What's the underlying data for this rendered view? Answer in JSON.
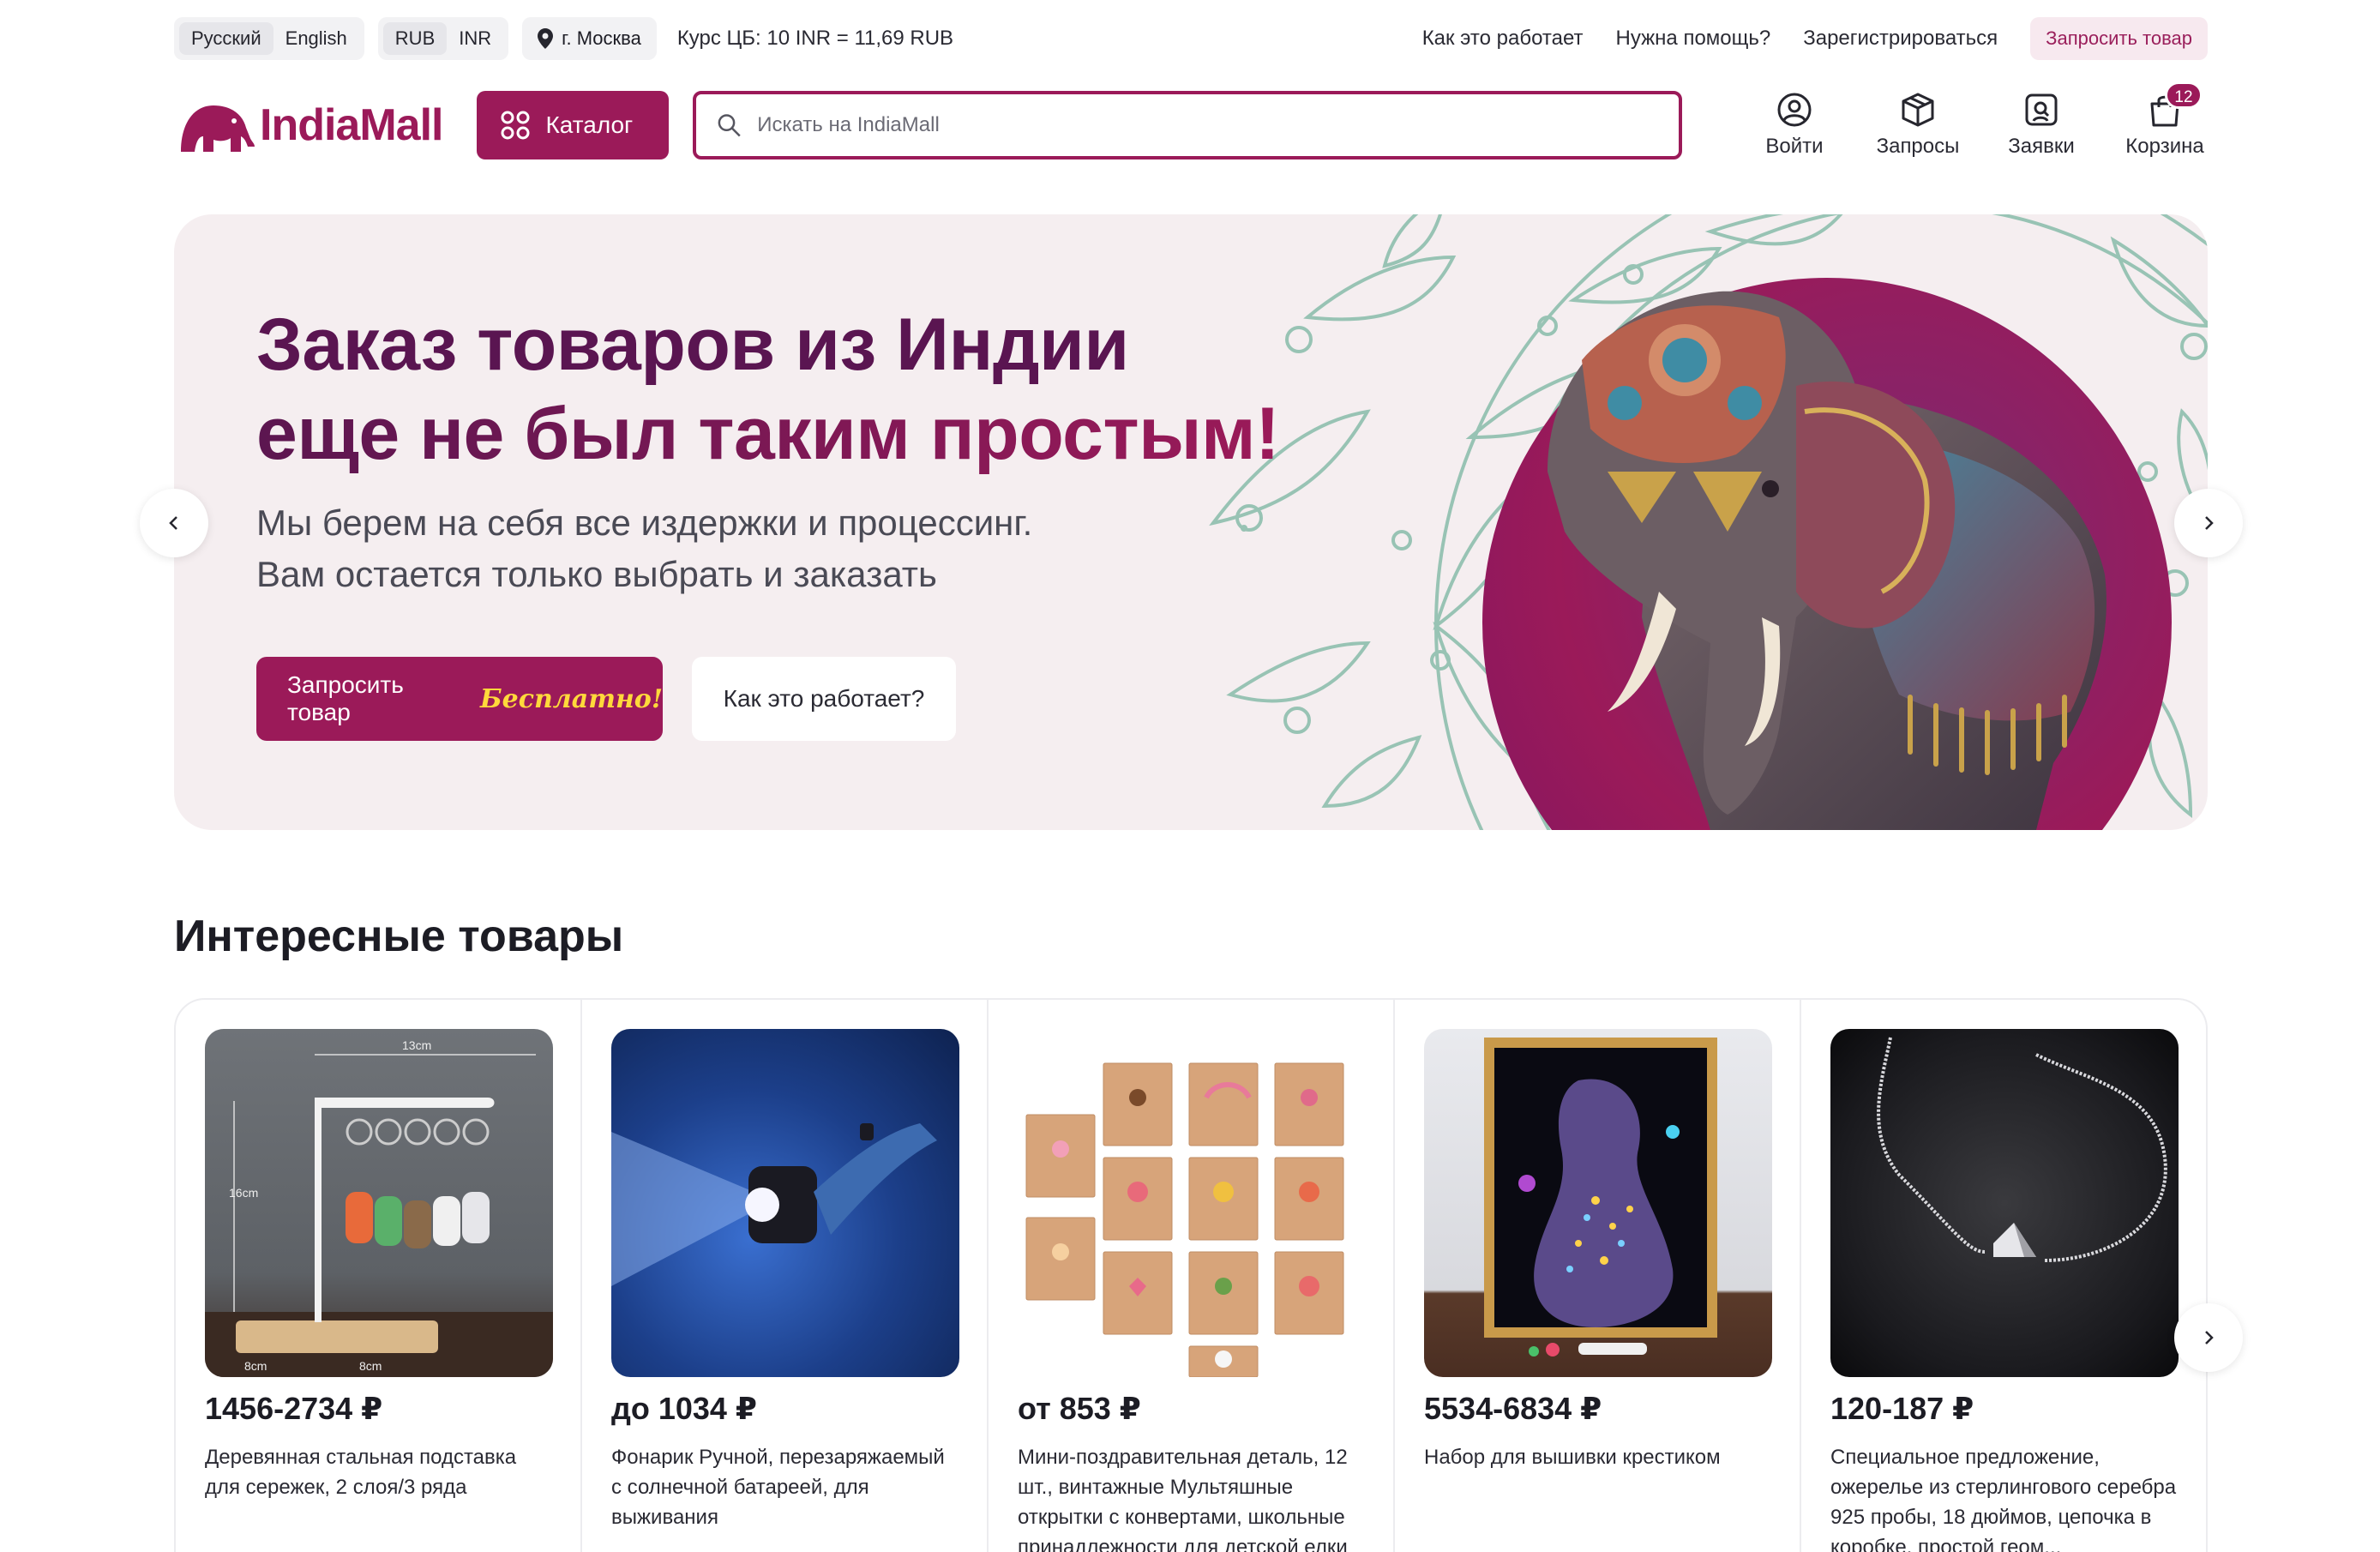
{
  "topbar": {
    "languages": [
      "Русский",
      "English"
    ],
    "currencies": [
      "RUB",
      "INR"
    ],
    "city": "г. Москва",
    "rate": "Курс ЦБ: 10 INR = 11,69 RUB",
    "links": [
      "Как это работает",
      "Нужна помощь?",
      "Зарегистрироваться"
    ],
    "request_button": "Запросить товар"
  },
  "header": {
    "logo_text": "IndiaMall",
    "catalog_label": "Каталог",
    "search_placeholder": "Искать на IndiaMall",
    "icons": [
      {
        "label": "Войти",
        "icon": "user-icon"
      },
      {
        "label": "Запросы",
        "icon": "box-icon"
      },
      {
        "label": "Заявки",
        "icon": "orders-icon"
      },
      {
        "label": "Корзина",
        "icon": "bag-icon"
      }
    ],
    "cart_count": "12"
  },
  "hero": {
    "title_line1": "Заказ товаров из Индии",
    "title_line2": "еще не был таким простым!",
    "subtitle_line1": "Мы берем на себя все издержки и процессинг.",
    "subtitle_line2": "Вам остается только выбрать и заказать",
    "primary_button": "Запросить товар",
    "primary_button_accent": "Бесплатно!",
    "secondary_button": "Как это работает?"
  },
  "products": {
    "title": "Интересные товары",
    "items": [
      {
        "price": "1456-2734 ₽",
        "name": "Деревянная стальная подставка для сережек, 2 слоя/3 ряда"
      },
      {
        "price": "до 1034 ₽",
        "name": "Фонарик Ручной, перезаряжаемый с солнечной батареей, для выживания"
      },
      {
        "price": "от 853 ₽",
        "name": "Мини-поздравительная деталь, 12 шт., винтажные Мультяшные открытки с конвертами, школьные принадлежности для детской елки"
      },
      {
        "price": "5534-6834 ₽",
        "name": "Набор для вышивки крестиком"
      },
      {
        "price": "120-187 ₽",
        "name": "Специальное предложение, ожерелье из стерлингового серебра 925 пробы, 18 дюймов, цепочка в коробке, простой геом..."
      }
    ],
    "img_labels": {
      "width": "13cm",
      "height": "16cm",
      "base_left": "8cm",
      "base_right": "8cm"
    }
  },
  "colors": {
    "brand": "#9b1a59",
    "hero_bg": "#f5eef0",
    "accent_yellow": "#ffd93b"
  }
}
